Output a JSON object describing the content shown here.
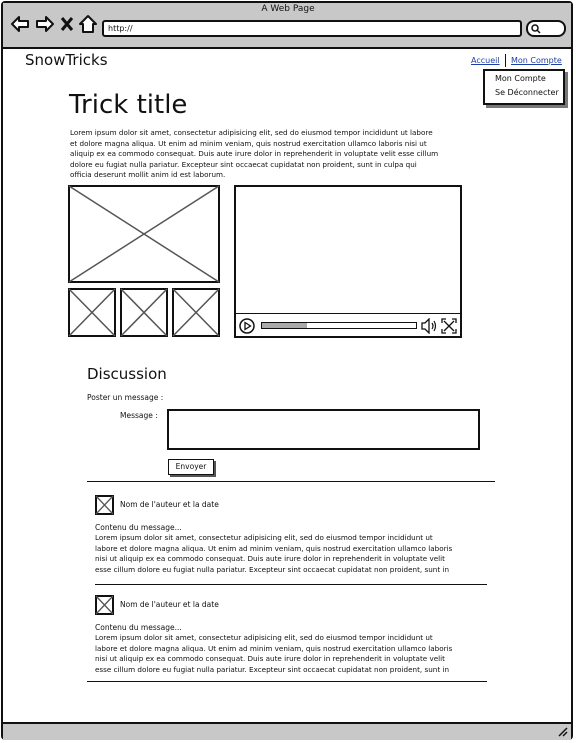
{
  "window": {
    "title": "A Web Page",
    "url": "http://"
  },
  "header": {
    "logo": "SnowTricks",
    "nav": {
      "home": "Accueil",
      "account": "Mon Compte"
    },
    "dropdown": [
      "Mon Compte",
      "Se Déconnecter"
    ]
  },
  "trick": {
    "title": "Trick title",
    "description": [
      "Lorem ipsum dolor sit amet, consectetur adipisicing elit, sed do eiusmod tempor incididunt ut labore",
      "et dolore magna aliqua. Ut enim ad minim veniam, quis nostrud exercitation ullamco laboris nisi ut",
      "aliquip ex ea commodo consequat. Duis aute irure dolor in reprehenderit in voluptate velit esse cillum",
      "dolore eu fugiat nulla pariatur. Excepteur sint occaecat cupidatat non proident, sunt in culpa qui",
      "officia deserunt mollit anim id est laborum."
    ],
    "video": {
      "progress": 0.29
    }
  },
  "discussion": {
    "title": "Discussion",
    "post_label": "Poster un message :",
    "message_label": "Message :",
    "message_value": "",
    "send_label": "Envoyer",
    "comments": [
      {
        "author": "Nom de l'auteur et la date",
        "content_label": "Contenu du message...",
        "lines": [
          "Lorem ipsum dolor sit amet, consectetur adipisicing elit, sed do eiusmod tempor incididunt ut",
          "labore et dolore magna aliqua. Ut enim ad minim veniam, quis nostrud exercitation ullamco laboris",
          "nisi ut aliquip ex ea commodo consequat. Duis aute irure dolor in reprehenderit in voluptate velit",
          "esse cillum dolore eu fugiat nulla pariatur. Excepteur sint occaecat cupidatat non proident, sunt in"
        ]
      },
      {
        "author": "Nom de l'auteur et la date",
        "content_label": "Contenu du message...",
        "lines": [
          "Lorem ipsum dolor sit amet, consectetur adipisicing elit, sed do eiusmod tempor incididunt ut",
          "labore et dolore magna aliqua. Ut enim ad minim veniam, quis nostrud exercitation ullamco laboris",
          "nisi ut aliquip ex ea commodo consequat. Duis aute irure dolor in reprehenderit in voluptate velit",
          "esse cillum dolore eu fugiat nulla pariatur. Excepteur sint occaecat cupidatat non proident, sunt in"
        ]
      }
    ]
  },
  "icons": [
    "back-arrow-icon",
    "forward-arrow-icon",
    "close-icon",
    "home-icon",
    "search-icon",
    "resize-grip-icon",
    "image-placeholder-icon",
    "play-icon",
    "volume-icon",
    "fullscreen-icon",
    "avatar-placeholder-icon"
  ]
}
